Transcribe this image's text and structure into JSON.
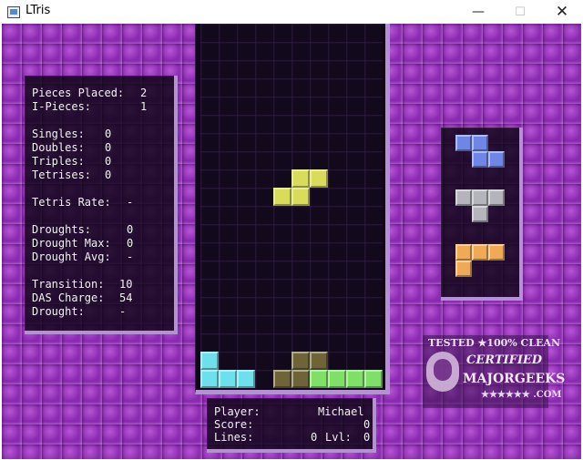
{
  "window": {
    "title": "LTris",
    "minimize_glyph": "—",
    "maximize_glyph": "☐",
    "close_glyph": "✕"
  },
  "stats": {
    "pieces_placed_label": "Pieces Placed:",
    "pieces_placed": "2",
    "i_pieces_label": "I-Pieces:",
    "i_pieces": "1",
    "singles_label": "Singles:",
    "singles": "0",
    "doubles_label": "Doubles:",
    "doubles": "0",
    "triples_label": "Triples:",
    "triples": "0",
    "tetrises_label": "Tetrises:",
    "tetrises": "0",
    "tetris_rate_label": "Tetris Rate:",
    "tetris_rate": "-",
    "droughts_label": "Droughts:",
    "droughts": "0",
    "drought_max_label": "Drought Max:",
    "drought_max": "0",
    "drought_avg_label": "Drought Avg:",
    "drought_avg": "-",
    "transition_label": "Transition:",
    "transition": "10",
    "das_charge_label": "DAS Charge:",
    "das_charge": "54",
    "drought_label": "Drought:",
    "drought": "-"
  },
  "info": {
    "player_label": "Player:",
    "player": "Michael",
    "score_label": "Score:",
    "score": "0",
    "lines_label": "Lines:",
    "lines": "0",
    "level_label": "Lvl:",
    "level": "0"
  },
  "colors": {
    "yellow": "#d8dc5a",
    "cyan": "#6ee0ec",
    "green": "#7ee066",
    "ghost": "#6e6438",
    "blue": "#6f86e6",
    "gray": "#b4b4bc",
    "orange": "#f0aa56"
  },
  "board": {
    "columns": 10,
    "rows": 20,
    "active_piece": {
      "shape": "S",
      "color": "yellow",
      "cells": [
        [
          5,
          8
        ],
        [
          6,
          8
        ],
        [
          4,
          9
        ],
        [
          5,
          9
        ]
      ]
    },
    "ghost_piece": {
      "shape": "S",
      "color": "ghost",
      "cells": [
        [
          5,
          18
        ],
        [
          6,
          18
        ],
        [
          4,
          19
        ],
        [
          5,
          19
        ]
      ]
    },
    "locked_cells": [
      {
        "col": 0,
        "row": 18,
        "color": "cyan"
      },
      {
        "col": 0,
        "row": 19,
        "color": "cyan"
      },
      {
        "col": 1,
        "row": 19,
        "color": "cyan"
      },
      {
        "col": 2,
        "row": 19,
        "color": "cyan"
      },
      {
        "col": 6,
        "row": 19,
        "color": "green"
      },
      {
        "col": 7,
        "row": 19,
        "color": "green"
      },
      {
        "col": 8,
        "row": 19,
        "color": "green"
      },
      {
        "col": 9,
        "row": 19,
        "color": "green"
      }
    ]
  },
  "next_pieces": [
    {
      "shape": "Z",
      "color": "blue",
      "cells": [
        [
          0,
          0
        ],
        [
          1,
          0
        ],
        [
          1,
          1
        ],
        [
          2,
          1
        ]
      ]
    },
    {
      "shape": "T",
      "color": "gray",
      "cells": [
        [
          0,
          0
        ],
        [
          1,
          0
        ],
        [
          2,
          0
        ],
        [
          1,
          1
        ]
      ]
    },
    {
      "shape": "L",
      "color": "orange",
      "cells": [
        [
          0,
          0
        ],
        [
          1,
          0
        ],
        [
          2,
          0
        ],
        [
          0,
          1
        ]
      ]
    }
  ],
  "badge": {
    "top_text": "TESTED ★100% CLEAN",
    "middle_text": "CERTIFIED",
    "brand_text": "MAJORGEEKS",
    "bottom_text": "★★★★★★ .COM"
  }
}
